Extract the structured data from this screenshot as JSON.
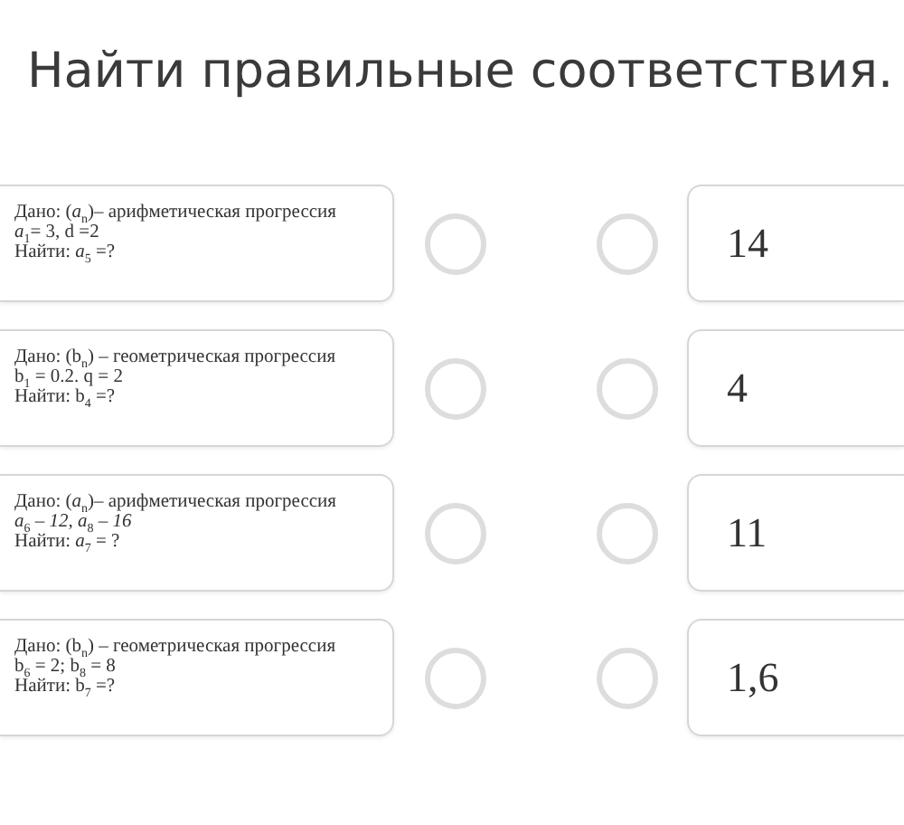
{
  "title": "Найти правильные соответствия.",
  "rows": [
    {
      "prompt": [
        "Дано: (*a*$_{n}$)– арифметическая прогрессия",
        "*a*$_{1}$= 3, d =2",
        "Найти: *a*$_{5}$ =?"
      ],
      "answer": "14"
    },
    {
      "prompt": [
        "Дано: (b$_{n}$) – геометрическая  прогрессия",
        "b$_{1}$ = 0.2. q = 2",
        "Найти: b$_{4}$ =?"
      ],
      "answer": "4"
    },
    {
      "prompt": [
        "Дано: (*a*$_{n}$)– арифметическая прогрессия",
        "*a*$_{6}$ – *12*, *a*$_{8}$ – *16*",
        "Найти: *a*$_{7}$ = ?"
      ],
      "answer": "11"
    },
    {
      "prompt": [
        "Дано: (b$_{n}$) – геометрическая  прогрессия",
        "b$_{6}$ = 2;  b$_{8}$ = 8",
        "Найти: b$_{7}$ =?"
      ],
      "answer": "1,6"
    }
  ]
}
